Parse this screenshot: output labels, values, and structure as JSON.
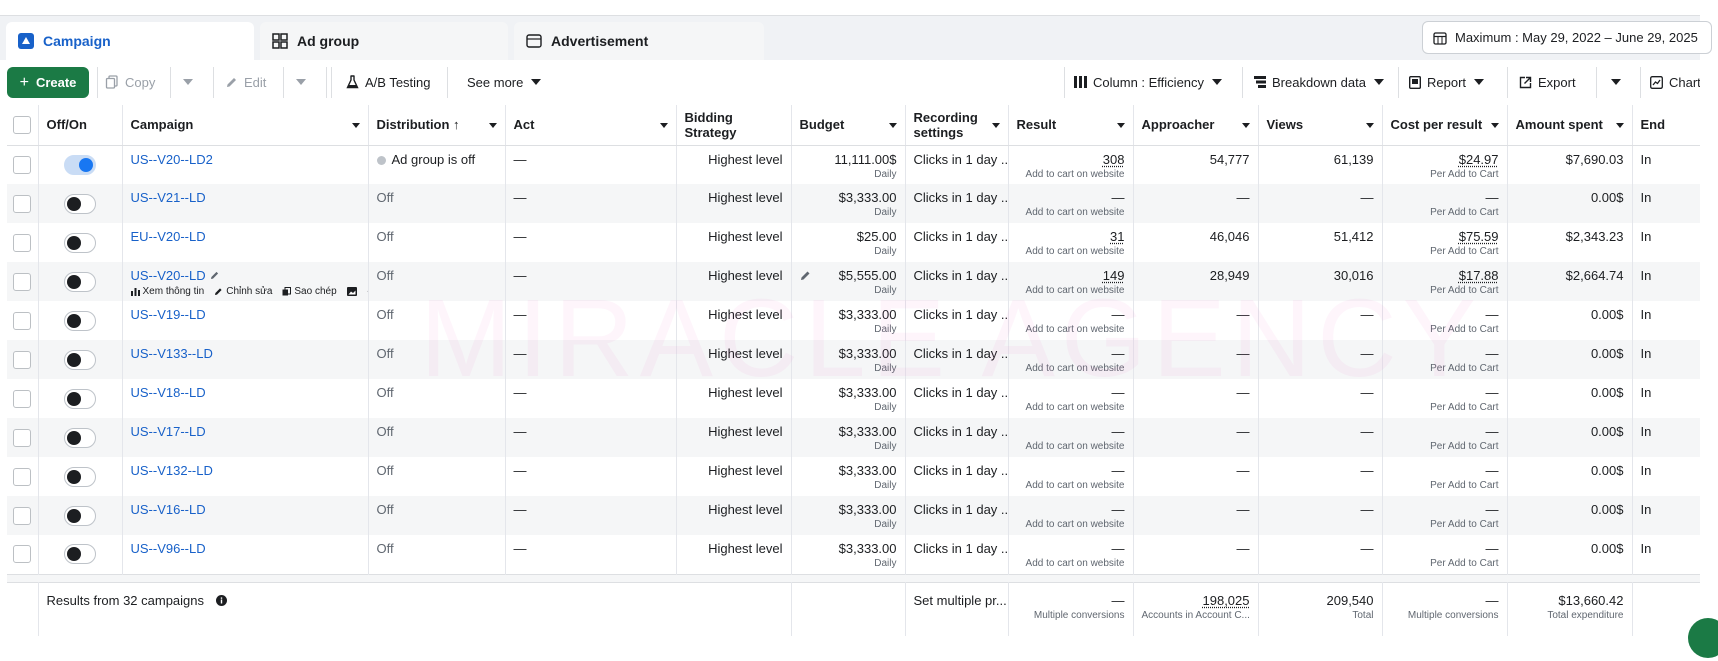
{
  "tabs": [
    {
      "label": "Campaign",
      "icon": "campaign-icon",
      "active": true
    },
    {
      "label": "Ad group",
      "icon": "ad-group-icon",
      "active": false
    },
    {
      "label": "Advertisement",
      "icon": "advertisement-icon",
      "active": false
    }
  ],
  "date_range": "Maximum : May 29, 2022 – June 29, 2025",
  "toolbar": {
    "create": "Create",
    "copy": "Copy",
    "edit": "Edit",
    "ab_testing": "A/B Testing",
    "see_more": "See more",
    "column": "Column : Efficiency",
    "breakdown": "Breakdown data",
    "report": "Report",
    "export": "Export",
    "chart": "Chart"
  },
  "columns": {
    "offon": "Off/On",
    "campaign": "Campaign",
    "distribution": "Distribution ↑",
    "act": "Act",
    "bidding_1": "Bidding",
    "bidding_2": "Strategy",
    "budget": "Budget",
    "recording_1": "Recording",
    "recording_2": "settings",
    "result": "Result",
    "approacher": "Approacher",
    "views": "Views",
    "cost": "Cost per result",
    "amount": "Amount spent",
    "end": "End"
  },
  "rows": [
    {
      "on": true,
      "name": "US--V20--LD2",
      "dist": "Ad group is off",
      "act": "—",
      "bid": "Highest level",
      "budget": "11,111.00$",
      "budget_sub": "Daily",
      "rec": "Clicks in 1 day ...",
      "result": "308",
      "result_sub": "Add to cart on website",
      "appr": "54,777",
      "views": "61,139",
      "cost": "$24.97",
      "cost_sub": "Per Add to Cart",
      "amount": "$7,690.03",
      "end": "In"
    },
    {
      "on": false,
      "name": "US--V21--LD",
      "dist": "Off",
      "act": "—",
      "bid": "Highest level",
      "budget": "$3,333.00",
      "budget_sub": "Daily",
      "rec": "Clicks in 1 day ...",
      "result": "—",
      "result_sub": "Add to cart on website",
      "appr": "—",
      "views": "—",
      "cost": "—",
      "cost_sub": "Per Add to Cart",
      "amount": "0.00$",
      "end": "In"
    },
    {
      "on": false,
      "name": "EU--V20--LD",
      "dist": "Off",
      "act": "—",
      "bid": "Highest level",
      "budget": "$25.00",
      "budget_sub": "Daily",
      "rec": "Clicks in 1 day ...",
      "result": "31",
      "result_sub": "Add to cart on website",
      "appr": "46,046",
      "views": "51,412",
      "cost": "$75.59",
      "cost_sub": "Per Add to Cart",
      "amount": "$2,343.23",
      "end": "In"
    },
    {
      "on": false,
      "name": "US--V20--LD",
      "dist": "Off",
      "act": "—",
      "bid": "Highest level",
      "budget": "$5,555.00",
      "budget_sub": "Daily",
      "rec": "Clicks in 1 day ...",
      "result": "149",
      "result_sub": "Add to cart on website",
      "appr": "28,949",
      "views": "30,016",
      "cost": "$17.88",
      "cost_sub": "Per Add to Cart",
      "amount": "$2,664.74",
      "end": "In"
    },
    {
      "on": false,
      "name": "US--V19--LD",
      "dist": "Off",
      "act": "—",
      "bid": "Highest level",
      "budget": "$3,333.00",
      "budget_sub": "Daily",
      "rec": "Clicks in 1 day ...",
      "result": "—",
      "result_sub": "Add to cart on website",
      "appr": "—",
      "views": "—",
      "cost": "—",
      "cost_sub": "Per Add to Cart",
      "amount": "0.00$",
      "end": "In"
    },
    {
      "on": false,
      "name": "US--V133--LD",
      "dist": "Off",
      "act": "—",
      "bid": "Highest level",
      "budget": "$3,333.00",
      "budget_sub": "Daily",
      "rec": "Clicks in 1 day ...",
      "result": "—",
      "result_sub": "Add to cart on website",
      "appr": "—",
      "views": "—",
      "cost": "—",
      "cost_sub": "Per Add to Cart",
      "amount": "0.00$",
      "end": "In"
    },
    {
      "on": false,
      "name": "US--V18--LD",
      "dist": "Off",
      "act": "—",
      "bid": "Highest level",
      "budget": "$3,333.00",
      "budget_sub": "Daily",
      "rec": "Clicks in 1 day ...",
      "result": "—",
      "result_sub": "Add to cart on website",
      "appr": "—",
      "views": "—",
      "cost": "—",
      "cost_sub": "Per Add to Cart",
      "amount": "0.00$",
      "end": "In"
    },
    {
      "on": false,
      "name": "US--V17--LD",
      "dist": "Off",
      "act": "—",
      "bid": "Highest level",
      "budget": "$3,333.00",
      "budget_sub": "Daily",
      "rec": "Clicks in 1 day ...",
      "result": "—",
      "result_sub": "Add to cart on website",
      "appr": "—",
      "views": "—",
      "cost": "—",
      "cost_sub": "Per Add to Cart",
      "amount": "0.00$",
      "end": "In"
    },
    {
      "on": false,
      "name": "US--V132--LD",
      "dist": "Off",
      "act": "—",
      "bid": "Highest level",
      "budget": "$3,333.00",
      "budget_sub": "Daily",
      "rec": "Clicks in 1 day ...",
      "result": "—",
      "result_sub": "Add to cart on website",
      "appr": "—",
      "views": "—",
      "cost": "—",
      "cost_sub": "Per Add to Cart",
      "amount": "0.00$",
      "end": "In"
    },
    {
      "on": false,
      "name": "US--V16--LD",
      "dist": "Off",
      "act": "—",
      "bid": "Highest level",
      "budget": "$3,333.00",
      "budget_sub": "Daily",
      "rec": "Clicks in 1 day ...",
      "result": "—",
      "result_sub": "Add to cart on website",
      "appr": "—",
      "views": "—",
      "cost": "—",
      "cost_sub": "Per Add to Cart",
      "amount": "0.00$",
      "end": "In"
    },
    {
      "on": false,
      "name": "US--V96--LD",
      "dist": "Off",
      "act": "—",
      "bid": "Highest level",
      "budget": "$3,333.00",
      "budget_sub": "Daily",
      "rec": "Clicks in 1 day ...",
      "result": "—",
      "result_sub": "Add to cart on website",
      "appr": "—",
      "views": "—",
      "cost": "—",
      "cost_sub": "Per Add to Cart",
      "amount": "0.00$",
      "end": "In"
    }
  ],
  "row_actions": {
    "view": "Xem thông tin",
    "edit": "Chỉnh sửa",
    "copy": "Sao chép",
    "more": "···"
  },
  "footer": {
    "results": "Results from 32 campaigns",
    "recording": "Set multiple pr...",
    "result": "—",
    "result_sub": "Multiple conversions",
    "appr": "198,025",
    "appr_sub": "Accounts in Account C...",
    "views": "209,540",
    "views_sub": "Total",
    "cost": "—",
    "cost_sub": "Multiple conversions",
    "amount": "$13,660.42",
    "amount_sub": "Total expenditure"
  },
  "watermark": "MIRACLE AGENCY",
  "colors": {
    "accent": "#1861c9",
    "create": "#1b7a45",
    "toggle_on": "#1877f2"
  }
}
